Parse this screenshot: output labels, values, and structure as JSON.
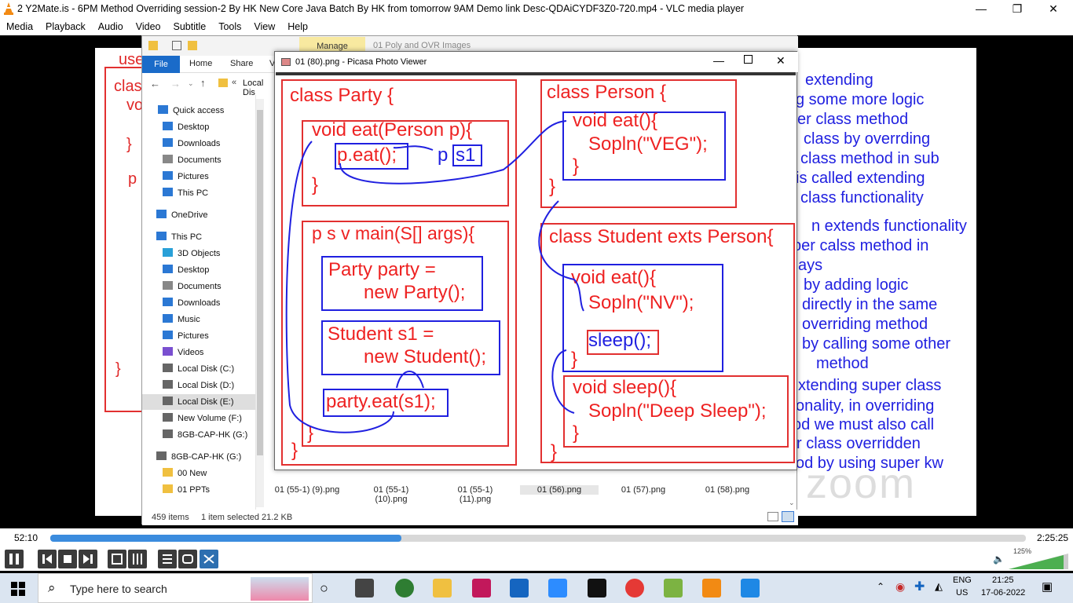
{
  "window": {
    "title": "2 Y2Mate.is - 6PM Method Overriding session-2 By HK New Core Java Batch By HK from tomorrow 9AM  Demo link Desc-QDAiCYDF3Z0-720.mp4 - VLC media player",
    "minimize": "—",
    "maximize": "❐",
    "close": "✕"
  },
  "menu": [
    "Media",
    "Playback",
    "Audio",
    "Video",
    "Subtitle",
    "Tools",
    "View",
    "Help"
  ],
  "slide": {
    "left_text": [
      "use",
      "clas",
      "vo",
      "}",
      "p",
      "}"
    ],
    "right_text": [
      "extending",
      "g some more logic",
      "er class method",
      "class by overrding",
      "class method in sub",
      "is called extending",
      "class functionality",
      "n extends functionality",
      "per calss method in",
      "ays",
      "by adding logic",
      "directly in the same",
      "overriding method",
      "by calling some other",
      "method",
      "xtending super class",
      "onality, in overriding",
      "od we must also call",
      "r class overridden",
      "od by using super kw"
    ],
    "zoom": "zoom"
  },
  "explorer": {
    "ribbon": {
      "manage": "Manage",
      "folder_title": "01 Poly and OVR Images"
    },
    "tabs": {
      "file": "File",
      "home": "Home",
      "share": "Share",
      "view": "V"
    },
    "address": "Local Dis",
    "nav_items": [
      {
        "label": "Quick access",
        "icon": "star-icon",
        "color": "#2b78d4"
      },
      {
        "label": "Desktop",
        "icon": "desktop-icon",
        "color": "#2b78d4"
      },
      {
        "label": "Downloads",
        "icon": "download-icon",
        "color": "#2b78d4"
      },
      {
        "label": "Documents",
        "icon": "documents-icon",
        "color": "#888"
      },
      {
        "label": "Pictures",
        "icon": "pictures-icon",
        "color": "#2b78d4"
      },
      {
        "label": "This PC",
        "icon": "pc-icon",
        "color": "#2b78d4"
      },
      {
        "label": "OneDrive",
        "icon": "cloud-icon",
        "color": "#2b78d4"
      },
      {
        "label": "This PC",
        "icon": "pc-icon",
        "color": "#2b78d4"
      },
      {
        "label": "3D Objects",
        "icon": "cube-icon",
        "color": "#29a0d8"
      },
      {
        "label": "Desktop",
        "icon": "desktop-icon",
        "color": "#2b78d4"
      },
      {
        "label": "Documents",
        "icon": "documents-icon",
        "color": "#888"
      },
      {
        "label": "Downloads",
        "icon": "download-icon",
        "color": "#2b78d4"
      },
      {
        "label": "Music",
        "icon": "music-icon",
        "color": "#2b78d4"
      },
      {
        "label": "Pictures",
        "icon": "pictures-icon",
        "color": "#2b78d4"
      },
      {
        "label": "Videos",
        "icon": "video-icon",
        "color": "#7a4fd0"
      },
      {
        "label": "Local Disk (C:)",
        "icon": "drive-icon",
        "color": "#666"
      },
      {
        "label": "Local Disk (D:)",
        "icon": "drive-icon",
        "color": "#666"
      },
      {
        "label": "Local Disk (E:)",
        "icon": "drive-icon",
        "color": "#666"
      },
      {
        "label": "New Volume (F:)",
        "icon": "drive-icon",
        "color": "#666"
      },
      {
        "label": "8GB-CAP-HK (G:)",
        "icon": "drive-icon",
        "color": "#666"
      },
      {
        "label": "8GB-CAP-HK (G:)",
        "icon": "drive-icon",
        "color": "#666"
      },
      {
        "label": "00 New",
        "icon": "folder-icon",
        "color": "#f0c040"
      },
      {
        "label": "01 PPTs",
        "icon": "folder-icon",
        "color": "#f0c040"
      }
    ],
    "thumbs": [
      "01 (55-1) (9).png",
      "01 (55-1)\n(10).png",
      "01 (55-1)\n(11).png",
      "01 (56).png",
      "01 (57).png",
      "01 (58).png"
    ],
    "status": {
      "count": "459 items",
      "selected": "1 item selected  21.2 KB"
    }
  },
  "picasa": {
    "title": "01 (80).png - Picasa Photo Viewer",
    "code": {
      "party_class": "class Party {",
      "void_eat_person": "void eat(Person p){",
      "p_eat": "p.eat();",
      "p_label": "p",
      "s1_label": "s1",
      "close1": "}",
      "close2": "}",
      "main": "p s v main(S[] args){",
      "party_decl1": "Party party =",
      "party_decl2": "new Party();",
      "student_decl1": "Student s1 =",
      "student_decl2": "new Student();",
      "party_call": "party.eat(s1);",
      "close3": "}",
      "close4": "}",
      "person_class": "class Person {",
      "person_eat": "void eat(){",
      "sopln_veg": "Sopln(\"VEG\");",
      "close5": "}",
      "close6": "}",
      "student_class": "class Student exts Person{",
      "student_eat": "void eat(){",
      "sopln_nv": "Sopln(\"NV\");",
      "sleep_call": "sleep();",
      "close7": "}",
      "void_sleep": "void sleep(){",
      "sopln_deep": "Sopln(\"Deep Sleep\");",
      "close8": "}",
      "close9": "}"
    }
  },
  "player": {
    "elapsed": "52:10",
    "total": "2:25:25",
    "progress": 0.36,
    "volume": "125%"
  },
  "taskbar": {
    "search_placeholder": "Type here to search",
    "lang1": "ENG",
    "lang2": "US",
    "time": "21:25",
    "date": "17-06-2022"
  }
}
